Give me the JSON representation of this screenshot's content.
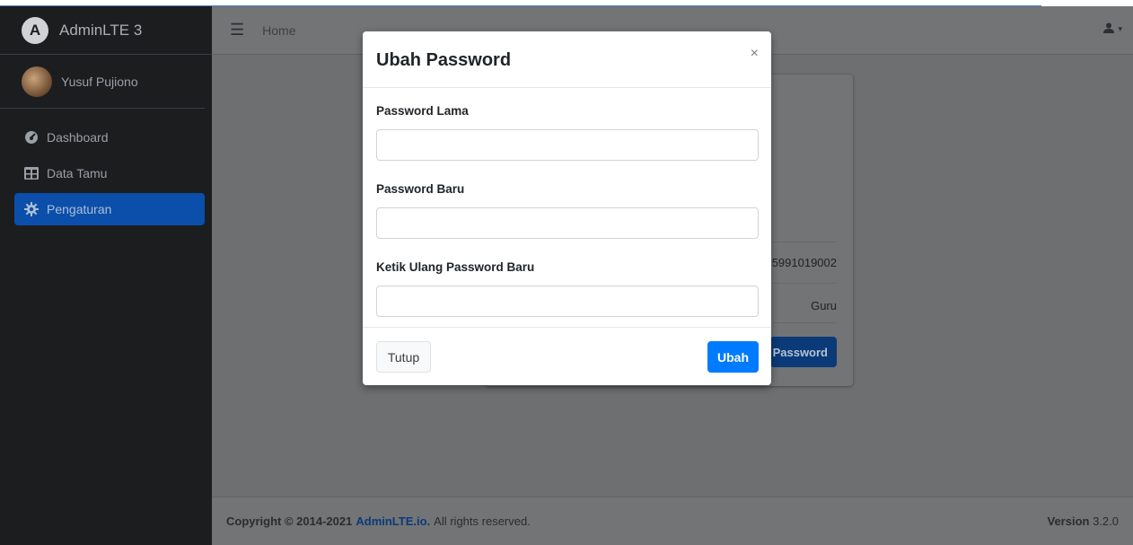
{
  "app": {
    "brand": "AdminLTE 3"
  },
  "sidebar": {
    "user_name": "Yusuf Pujiono",
    "items": [
      {
        "label": "Dashboard",
        "icon": "dashboard-icon"
      },
      {
        "label": "Data Tamu",
        "icon": "table-icon"
      },
      {
        "label": "Pengaturan",
        "icon": "gear-icon",
        "active": true
      }
    ]
  },
  "navbar": {
    "home": "Home",
    "menu_icon": "bars-icon",
    "user_icon": "user-icon"
  },
  "background_card": {
    "nip": "5991019002",
    "role": "Guru",
    "button_label": "Password"
  },
  "modal": {
    "title": "Ubah Password",
    "close_symbol": "×",
    "fields": [
      {
        "label": "Password Lama",
        "value": ""
      },
      {
        "label": "Password Baru",
        "value": ""
      },
      {
        "label": "Ketik Ulang Password Baru",
        "value": ""
      }
    ],
    "close_label": "Tutup",
    "submit_label": "Ubah"
  },
  "footer": {
    "copyright": "Copyright © 2014-2021",
    "brand_link": "AdminLTE.io.",
    "rights": "All rights reserved.",
    "version_label": "Version",
    "version": "3.2.0"
  },
  "colors": {
    "accent": "#007bff",
    "sidebar_active": "#0b4faa",
    "sidebar_bg": "#1b1d1f"
  }
}
